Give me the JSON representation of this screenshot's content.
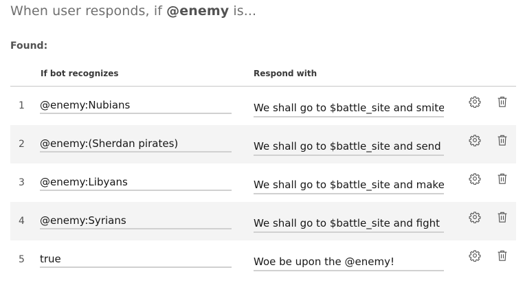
{
  "heading": {
    "prefix": "When user responds, if ",
    "entity": "@enemy",
    "suffix": " is..."
  },
  "found_label": "Found:",
  "table": {
    "columns": {
      "condition": "If bot recognizes",
      "response": "Respond with"
    },
    "rows": [
      {
        "number": "1",
        "condition": "@enemy:Nubians",
        "response": "We shall go to $battle_site and smite"
      },
      {
        "number": "2",
        "condition": "@enemy:(Sherdan pirates)",
        "response": "We shall go to $battle_site and send"
      },
      {
        "number": "3",
        "condition": "@enemy:Libyans",
        "response": "We shall go to $battle_site and make"
      },
      {
        "number": "4",
        "condition": "@enemy:Syrians",
        "response": "We shall go to $battle_site and fight u"
      },
      {
        "number": "5",
        "condition": "true",
        "response": "Woe be upon the @enemy!"
      }
    ],
    "row_actions": {
      "settings_icon": "gear-icon",
      "delete_icon": "trash-icon"
    }
  }
}
